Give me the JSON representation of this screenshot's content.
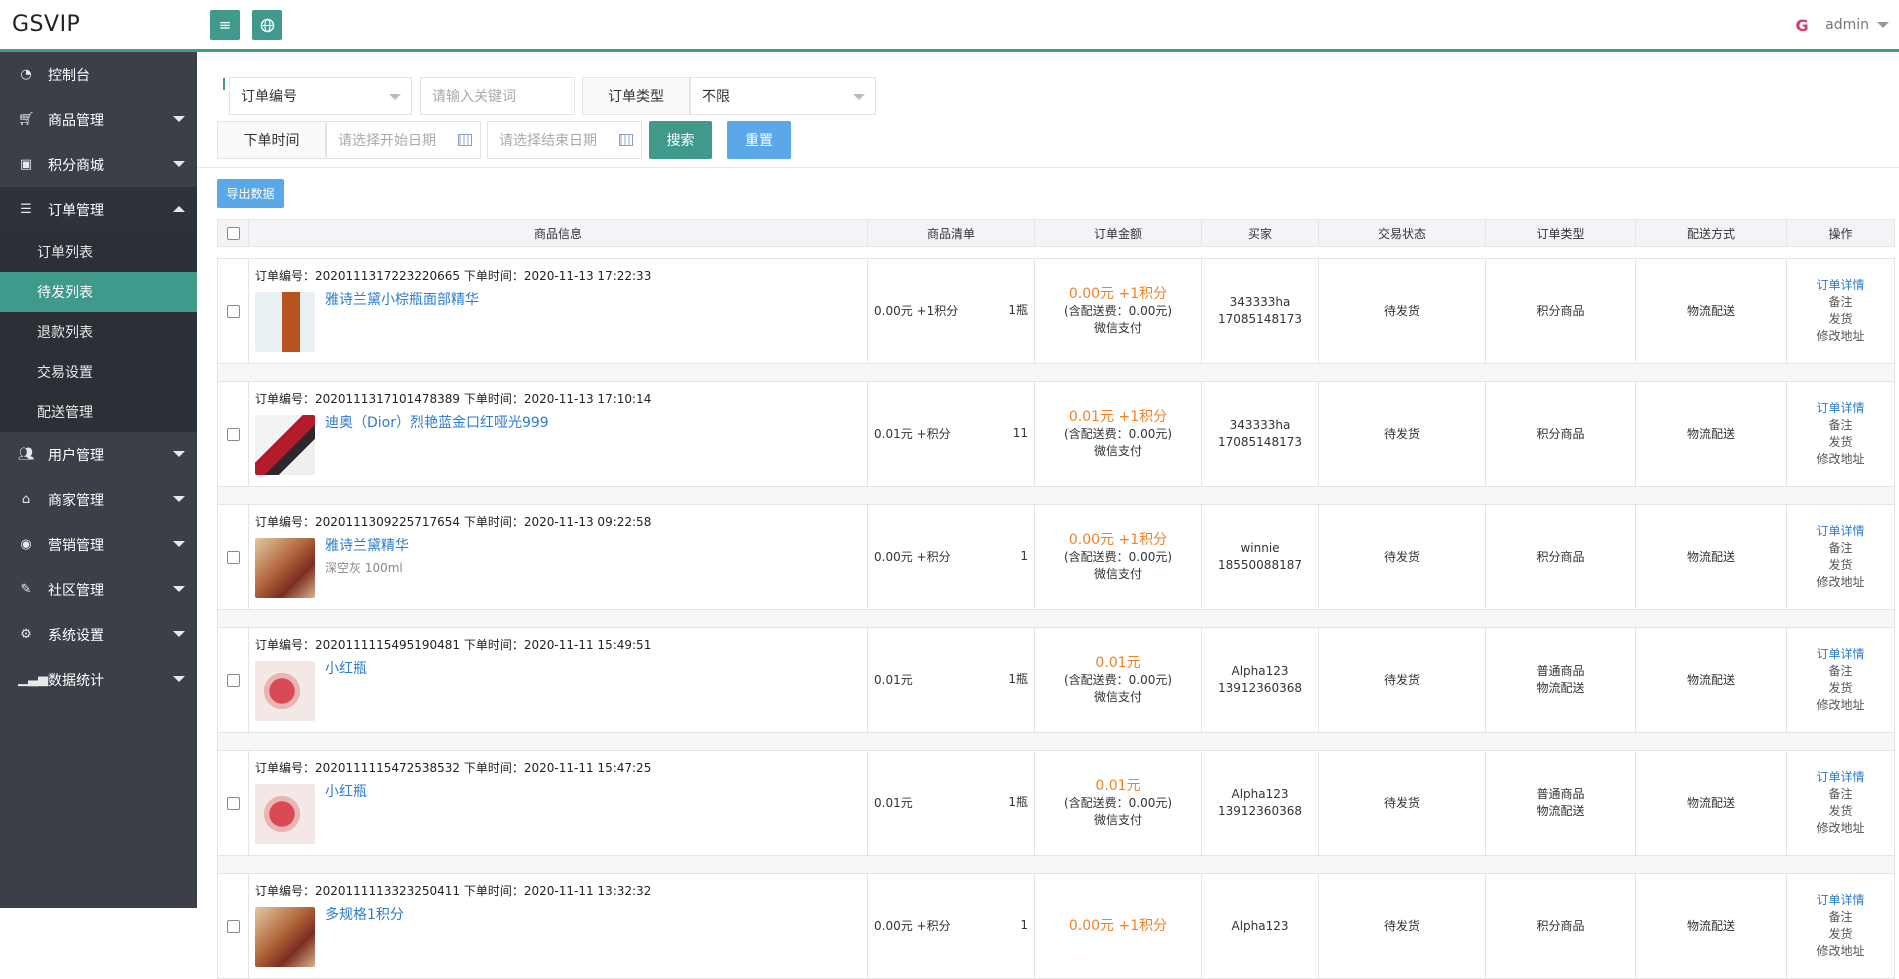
{
  "app": {
    "logo": "GSVIP",
    "user": "admin",
    "avatar_text": "G"
  },
  "topbar": {
    "menu_icon": "menu-icon",
    "globe_icon": "globe-icon"
  },
  "sidebar": {
    "items": [
      {
        "label": "控制台",
        "icon": "dashboard-icon",
        "caret": false
      },
      {
        "label": "商品管理",
        "icon": "cart-icon",
        "caret": true
      },
      {
        "label": "积分商城",
        "icon": "gift-icon",
        "caret": true
      },
      {
        "label": "订单管理",
        "icon": "list-icon",
        "caret": true,
        "open": true,
        "children": [
          {
            "label": "订单列表"
          },
          {
            "label": "待发列表",
            "active": true
          },
          {
            "label": "退款列表"
          },
          {
            "label": "交易设置"
          },
          {
            "label": "配送管理"
          }
        ]
      },
      {
        "label": "用户管理",
        "icon": "users-icon",
        "caret": true
      },
      {
        "label": "商家管理",
        "icon": "home-icon",
        "caret": true
      },
      {
        "label": "营销管理",
        "icon": "gauge-icon",
        "caret": true
      },
      {
        "label": "社区管理",
        "icon": "wrench-icon",
        "caret": true
      },
      {
        "label": "系统设置",
        "icon": "cogs-icon",
        "caret": true
      },
      {
        "label": "数据统计",
        "icon": "chart-icon",
        "caret": true
      }
    ]
  },
  "filters": {
    "field_select": "订单编号",
    "keyword_placeholder": "请输入关键词",
    "type_label": "订单类型",
    "type_value": "不限",
    "time_label": "下单时间",
    "start_placeholder": "请选择开始日期",
    "end_placeholder": "请选择结束日期",
    "search_label": "搜索",
    "reset_label": "重置",
    "export_label": "导出数据"
  },
  "table": {
    "headers": [
      "商品信息",
      "商品清单",
      "订单金额",
      "买家",
      "交易状态",
      "订单类型",
      "配送方式",
      "操作"
    ],
    "orders": [
      {
        "head": "订单编号：2020111317223220665 下单时间：2020-11-13 17:22:33",
        "product": "雅诗兰黛小棕瓶面部精华",
        "spec": "",
        "list_price": "0.00元 +1积分",
        "list_qty": "1瓶",
        "amount": "0.00元 +1积分",
        "fee": "(含配送费：0.00元)",
        "pay": "微信支付",
        "buyer_name": "343333ha",
        "buyer_phone": "17085148173",
        "status": "待发货",
        "type1": "积分商品",
        "type2": "",
        "delivery": "物流配送",
        "thumb": "bottle"
      },
      {
        "head": "订单编号：2020111317101478389 下单时间：2020-11-13 17:10:14",
        "product": "迪奥（Dior）烈艳蓝金口红哑光999",
        "spec": "",
        "list_price": "0.01元 +积分",
        "list_qty": "11",
        "amount": "0.01元 +1积分",
        "fee": "(含配送费：0.00元)",
        "pay": "微信支付",
        "buyer_name": "343333ha",
        "buyer_phone": "17085148173",
        "status": "待发货",
        "type1": "积分商品",
        "type2": "",
        "delivery": "物流配送",
        "thumb": "lipstick"
      },
      {
        "head": "订单编号：2020111309225717654 下单时间：2020-11-13 09:22:58",
        "product": "雅诗兰黛精华",
        "spec": "深空灰 100ml",
        "list_price": "0.00元 +积分",
        "list_qty": "1",
        "amount": "0.00元 +1积分",
        "fee": "(含配送费：0.00元)",
        "pay": "微信支付",
        "buyer_name": "winnie",
        "buyer_phone": "18550088187",
        "status": "待发货",
        "type1": "积分商品",
        "type2": "",
        "delivery": "物流配送",
        "thumb": "essence"
      },
      {
        "head": "订单编号：2020111115495190481 下单时间：2020-11-11 15:49:51",
        "product": "小红瓶",
        "spec": "",
        "list_price": "0.01元",
        "list_qty": "1瓶",
        "amount": "0.01元",
        "fee": "(含配送费：0.00元)",
        "pay": "微信支付",
        "buyer_name": "Alpha123",
        "buyer_phone": "13912360368",
        "status": "待发货",
        "type1": "普通商品",
        "type2": "物流配送",
        "delivery": "物流配送",
        "thumb": "red"
      },
      {
        "head": "订单编号：2020111115472538532 下单时间：2020-11-11 15:47:25",
        "product": "小红瓶",
        "spec": "",
        "list_price": "0.01元",
        "list_qty": "1瓶",
        "amount": "0.01元",
        "fee": "(含配送费：0.00元)",
        "pay": "微信支付",
        "buyer_name": "Alpha123",
        "buyer_phone": "13912360368",
        "status": "待发货",
        "type1": "普通商品",
        "type2": "物流配送",
        "delivery": "物流配送",
        "thumb": "red"
      },
      {
        "head": "订单编号：2020111113323250411 下单时间：2020-11-11 13:32:32",
        "product": "多规格1积分",
        "spec": "",
        "list_price": "0.00元 +积分",
        "list_qty": "1",
        "amount": "0.00元 +1积分",
        "fee": "",
        "pay": "",
        "buyer_name": "Alpha123",
        "buyer_phone": "",
        "status": "待发货",
        "type1": "积分商品",
        "type2": "",
        "delivery": "物流配送",
        "thumb": "essence"
      }
    ],
    "ops": [
      "订单详情",
      "备注",
      "发货",
      "修改地址"
    ]
  }
}
